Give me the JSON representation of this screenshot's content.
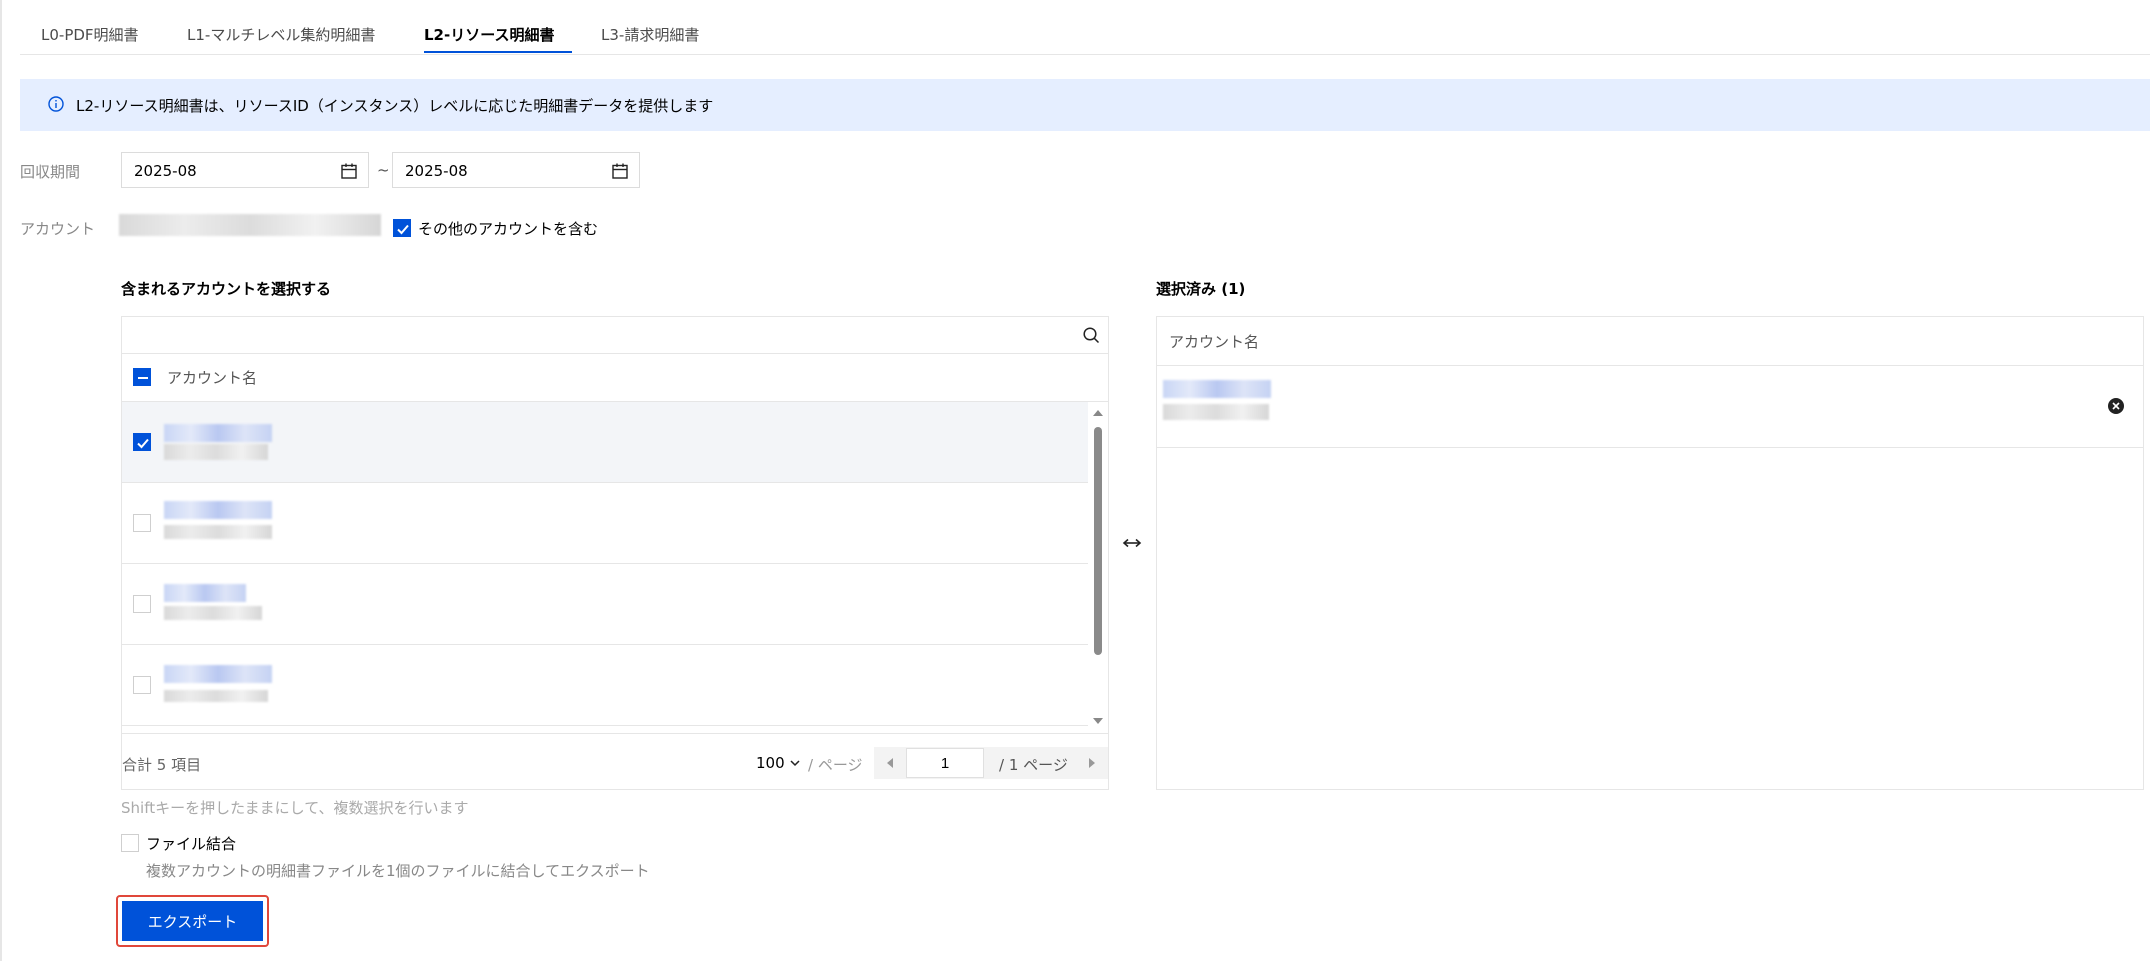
{
  "tabs": [
    {
      "label": "L0-PDF明細書"
    },
    {
      "label": "L1-マルチレベル集約明細書"
    },
    {
      "label": "L2-リソース明細書"
    },
    {
      "label": "L3-請求明細書"
    }
  ],
  "active_tab": 2,
  "banner": {
    "text": "L2-リソース明細書は、リソースID（インスタンス）レベルに応じた明細書データを提供します"
  },
  "period": {
    "label": "回収期間",
    "start": "2025-08",
    "separator": "~",
    "end": "2025-08"
  },
  "account": {
    "label": "アカウント",
    "include_others_label": "その他のアカウントを含む",
    "include_others_checked": true
  },
  "left_panel": {
    "title": "含まれるアカウントを選択する",
    "search_placeholder": "",
    "column_header": "アカウント名",
    "rows": [
      {
        "checked": true
      },
      {
        "checked": false
      },
      {
        "checked": false
      },
      {
        "checked": false
      }
    ],
    "total": "合計 5 項目",
    "page_size": "100",
    "per_page": "/ ページ",
    "current_page": "1",
    "total_pages": "/ 1 ページ"
  },
  "right_panel": {
    "title": "選択済み (1)",
    "column_header": "アカウント名"
  },
  "hint": "Shiftキーを押したままにして、複数選択を行います",
  "merge": {
    "label": "ファイル結合",
    "description": "複数アカウントの明細書ファイルを1個のファイルに結合してエクスポート",
    "checked": false
  },
  "export_button": "エクスポート",
  "colors": {
    "primary": "#0052d9",
    "banner_bg": "#e5eeff",
    "highlight": "#e0473a"
  }
}
